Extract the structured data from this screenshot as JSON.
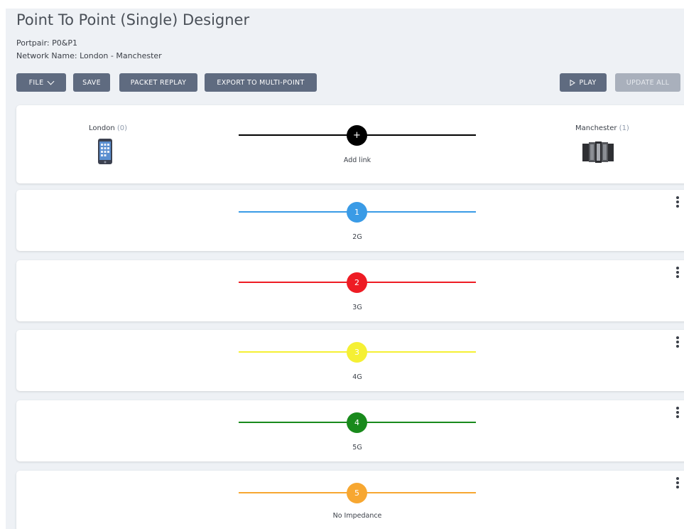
{
  "page": {
    "title": "Point To Point (Single) Designer",
    "portpair": "Portpair: P0&P1",
    "network": "Network Name: London - Manchester"
  },
  "toolbar": {
    "file": "FILE",
    "save": "SAVE",
    "packet_replay": "PACKET REPLAY",
    "export": "EXPORT TO MULTI-POINT",
    "play": "PLAY",
    "update_all": "UPDATE ALL"
  },
  "endpoints": {
    "left": {
      "name": "London",
      "count": "(0)",
      "icon": "mobile-phone-icon"
    },
    "right": {
      "name": "Manchester",
      "count": "(1)",
      "icon": "server-rack-icon"
    },
    "add_link": {
      "symbol": "+",
      "label": "Add link"
    }
  },
  "links": [
    {
      "number": "1",
      "label": "2G",
      "color": "#3a9be6"
    },
    {
      "number": "2",
      "label": "3G",
      "color": "#ee1c24"
    },
    {
      "number": "3",
      "label": "4G",
      "color": "#f5f034"
    },
    {
      "number": "4",
      "label": "5G",
      "color": "#198a1c"
    },
    {
      "number": "5",
      "label": "No Impedance",
      "color": "#f7a731"
    }
  ]
}
